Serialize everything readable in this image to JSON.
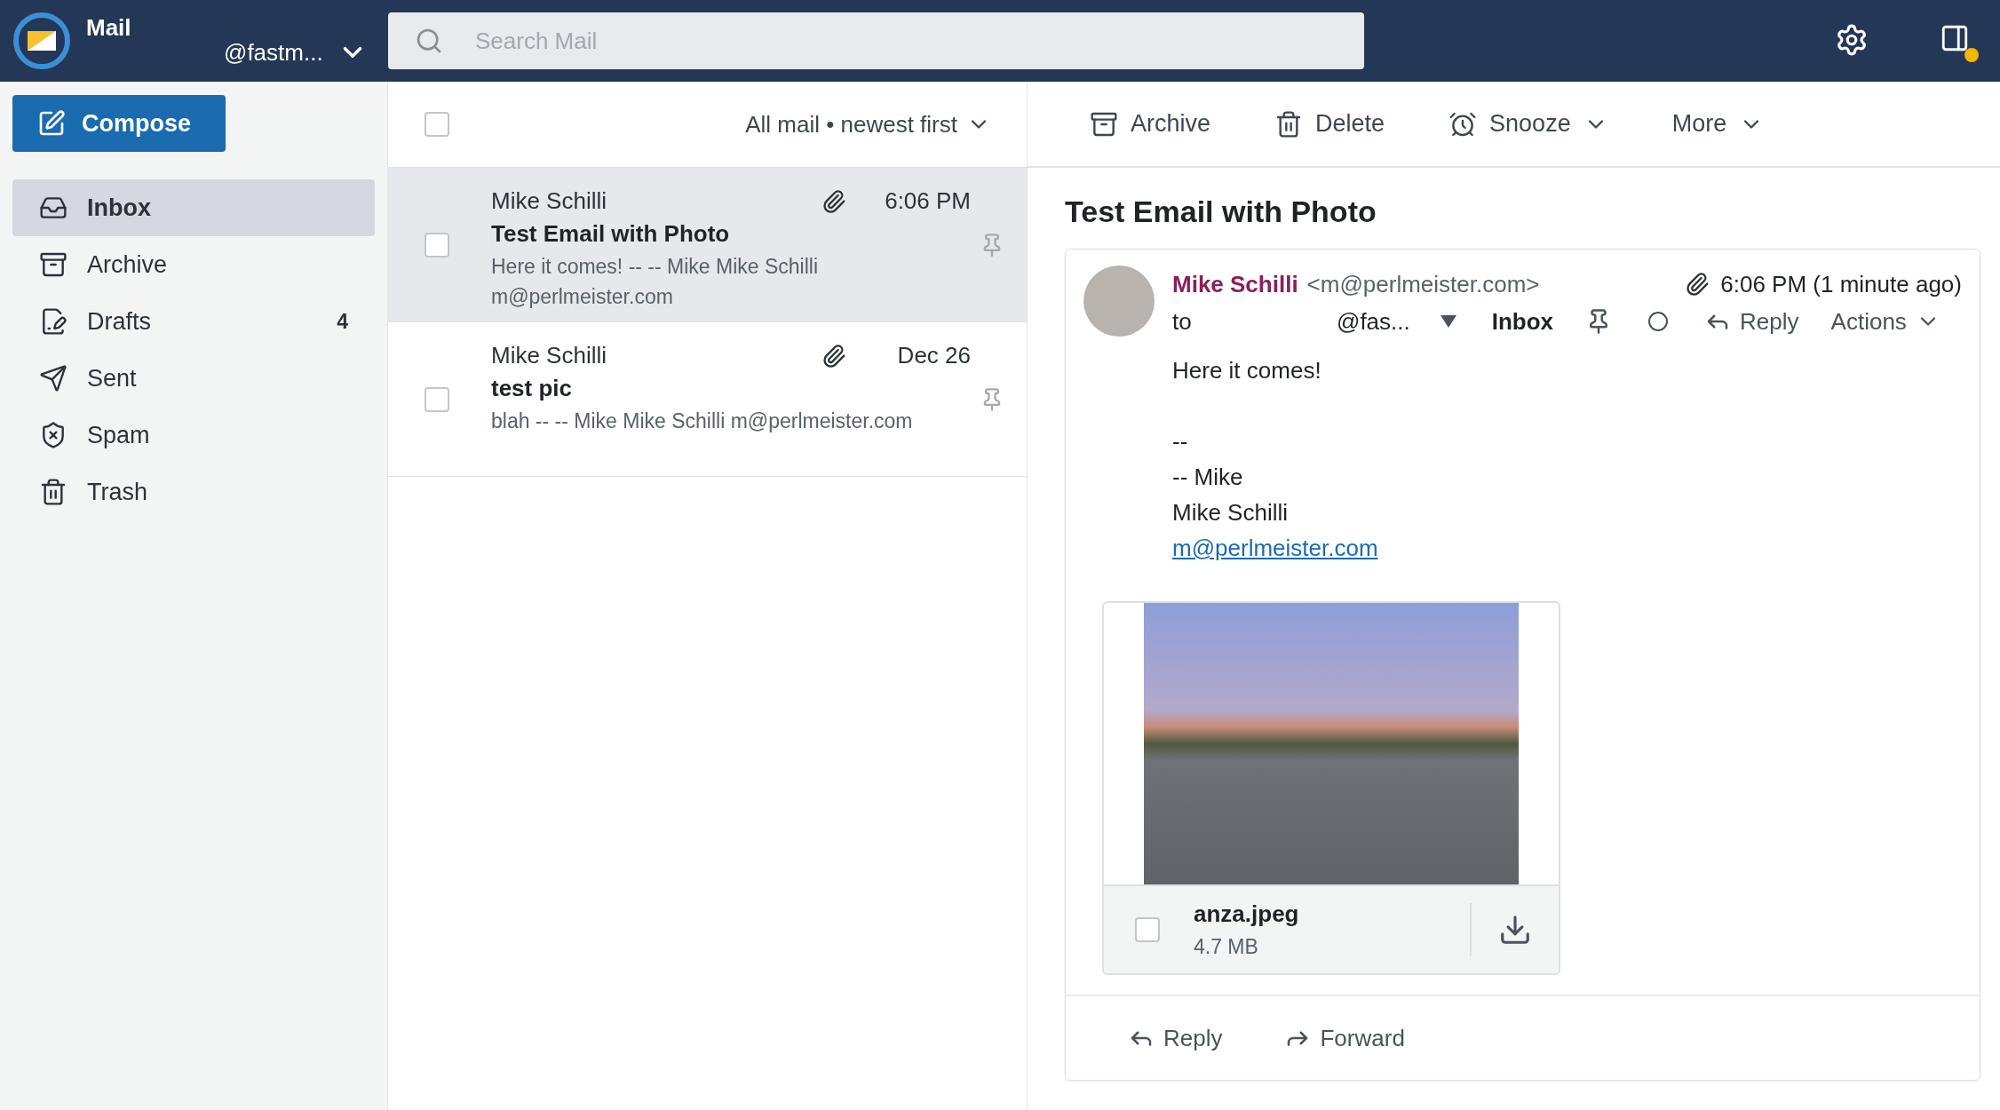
{
  "header": {
    "app_name": "Mail",
    "account": "@fastm...",
    "search": {
      "placeholder": "Search Mail"
    }
  },
  "sidebar": {
    "compose": "Compose",
    "folders": [
      {
        "kind": "inbox",
        "label": "Inbox",
        "selected": true
      },
      {
        "kind": "archive",
        "label": "Archive",
        "selected": false
      },
      {
        "kind": "drafts",
        "label": "Drafts",
        "count": "4",
        "selected": false
      },
      {
        "kind": "sent",
        "label": "Sent",
        "selected": false
      },
      {
        "kind": "spam",
        "label": "Spam",
        "selected": false
      },
      {
        "kind": "trash",
        "label": "Trash",
        "selected": false
      }
    ]
  },
  "message_list": {
    "select_all": {
      "checked": false
    },
    "sort": "All mail • newest first",
    "messages": [
      {
        "sender": "Mike Schilli",
        "subject": "Test Email with Photo",
        "preview": "Here it comes! -- -- Mike Mike Schilli m@perlmeister.com",
        "time": "6:06 PM",
        "has_attachment": true,
        "selected": true,
        "checked": false
      },
      {
        "sender": "Mike Schilli",
        "subject": "test pic",
        "preview": "blah -- -- Mike Mike Schilli m@perlmeister.com",
        "time": "Dec 26",
        "has_attachment": true,
        "selected": false,
        "checked": false
      }
    ]
  },
  "reader": {
    "toolbar": [
      {
        "kind": "archive",
        "label": "Archive",
        "dropdown": false
      },
      {
        "kind": "delete",
        "label": "Delete",
        "dropdown": false
      },
      {
        "kind": "snooze",
        "label": "Snooze",
        "dropdown": true
      },
      {
        "kind": "more",
        "label": "More",
        "dropdown": true
      }
    ],
    "subject": "Test Email with Photo",
    "message": {
      "sender_name": "Mike Schilli",
      "sender_email": "<m@perlmeister.com>",
      "time": "6:06 PM (1 minute ago)",
      "to_label": "to",
      "recipient": "@fas...",
      "folder": "Inbox",
      "reply": "Reply",
      "actions": "Actions",
      "greeting": "Here it comes!",
      "signature": [
        "--",
        "-- Mike",
        "Mike Schilli"
      ],
      "link": "m@perlmeister.com",
      "attachment": {
        "filename": "anza.jpeg",
        "size": "4.7 MB",
        "checked": false
      }
    },
    "footer": [
      {
        "kind": "reply",
        "label": "Reply"
      },
      {
        "kind": "forward",
        "label": "Forward"
      }
    ]
  }
}
